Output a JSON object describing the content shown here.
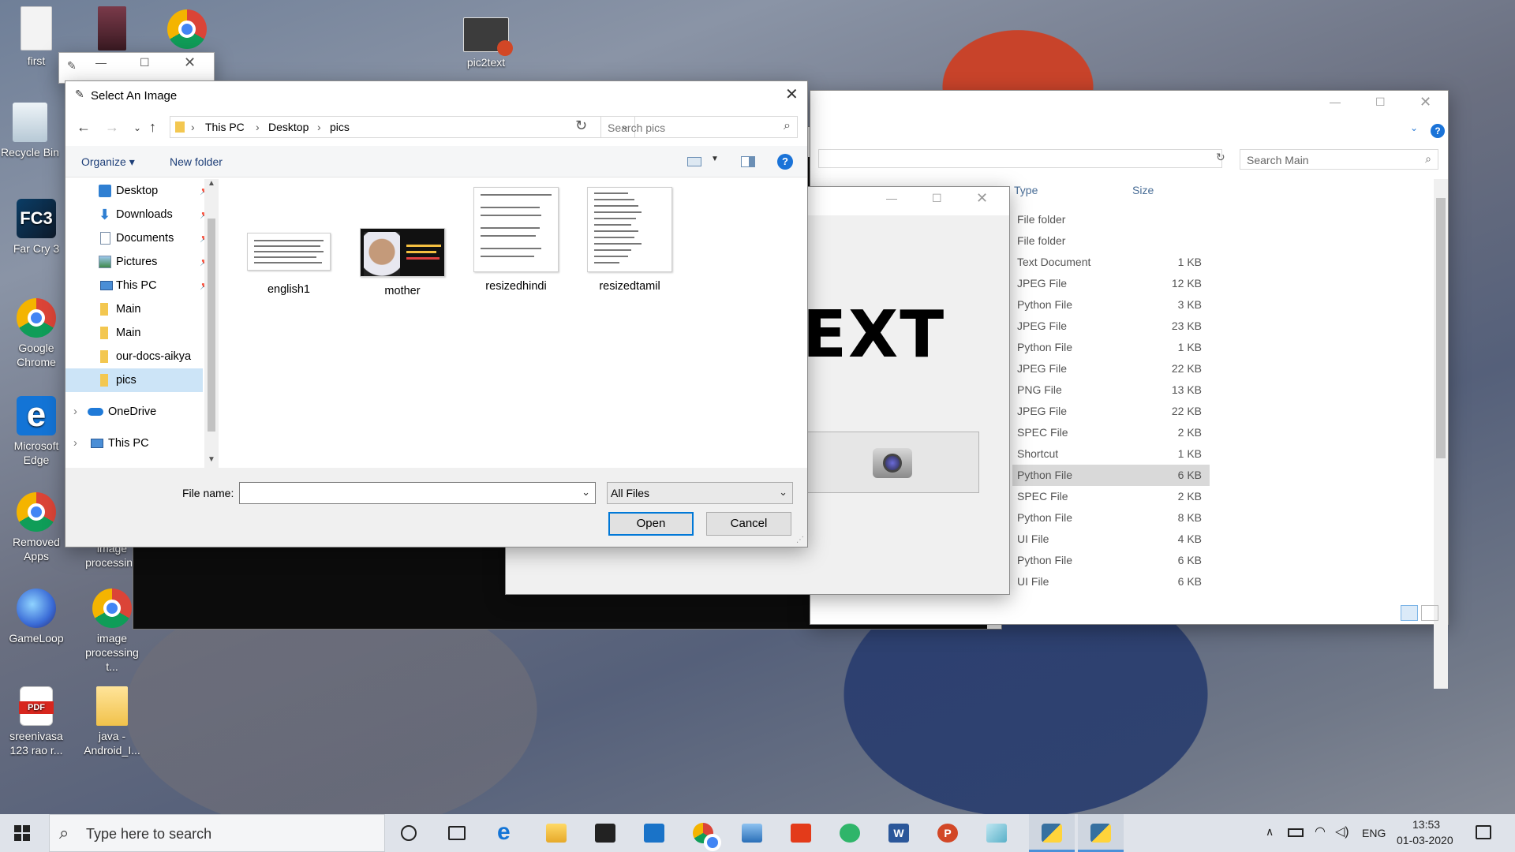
{
  "desktop_icons": [
    {
      "label": "first",
      "icon": "text-file-icon"
    },
    {
      "label": "Recycle Bin",
      "icon": "recycle-bin-icon"
    },
    {
      "label": "Far Cry 3",
      "icon": "far-cry-3-icon"
    },
    {
      "label": "Google Chrome",
      "icon": "chrome-icon"
    },
    {
      "label": "Microsoft Edge",
      "icon": "edge-icon"
    },
    {
      "label": "Removed Apps",
      "icon": "chrome-icon"
    },
    {
      "label": "image processing",
      "icon": "folder-icon"
    },
    {
      "label": "GameLoop",
      "icon": "gameloop-icon"
    },
    {
      "label": "image processing t...",
      "icon": "chrome-icon"
    },
    {
      "label": "sreenivasa 123 rao r...",
      "icon": "pdf-icon"
    },
    {
      "label": "java - Android_I...",
      "icon": "folder-icon"
    },
    {
      "label": "pic2text",
      "icon": "powerpoint-file-icon"
    }
  ],
  "explorer": {
    "search_placeholder": "Search Main",
    "columns": {
      "type": "Type",
      "size": "Size"
    },
    "rows": [
      {
        "type": "File folder",
        "size": ""
      },
      {
        "type": "File folder",
        "size": ""
      },
      {
        "type": "Text Document",
        "size": "1 KB"
      },
      {
        "type": "JPEG File",
        "size": "12 KB"
      },
      {
        "type": "Python File",
        "size": "3 KB"
      },
      {
        "type": "JPEG File",
        "size": "23 KB"
      },
      {
        "type": "Python File",
        "size": "1 KB"
      },
      {
        "type": "JPEG File",
        "size": "22 KB"
      },
      {
        "type": "PNG File",
        "size": "13 KB"
      },
      {
        "type": "JPEG File",
        "size": "22 KB"
      },
      {
        "type": "SPEC File",
        "size": "2 KB"
      },
      {
        "type": "Shortcut",
        "size": "1 KB"
      },
      {
        "type": "Python File",
        "size": "6 KB"
      },
      {
        "type": "SPEC File",
        "size": "2 KB"
      },
      {
        "type": "Python File",
        "size": "8 KB"
      },
      {
        "type": "UI File",
        "size": "4 KB"
      },
      {
        "type": "Python File",
        "size": "6 KB"
      },
      {
        "type": "UI File",
        "size": "6 KB"
      }
    ]
  },
  "app_window": {
    "heading": "EXT"
  },
  "dialog": {
    "title": "Select An Image",
    "breadcrumb": [
      "This PC",
      "Desktop",
      "pics"
    ],
    "search_placeholder": "Search pics",
    "toolbar": {
      "organize": "Organize",
      "new_folder": "New folder"
    },
    "nav_items": [
      {
        "label": "Desktop",
        "icon": "desktop-icon",
        "pinned": true
      },
      {
        "label": "Downloads",
        "icon": "downloads-icon",
        "pinned": true
      },
      {
        "label": "Documents",
        "icon": "documents-icon",
        "pinned": true
      },
      {
        "label": "Pictures",
        "icon": "pictures-icon",
        "pinned": true
      },
      {
        "label": "This PC",
        "icon": "this-pc-icon",
        "pinned": true
      },
      {
        "label": "Main",
        "icon": "folder-icon",
        "pinned": false
      },
      {
        "label": "Main",
        "icon": "folder-icon",
        "pinned": false
      },
      {
        "label": "our-docs-aikya",
        "icon": "folder-icon",
        "pinned": false
      },
      {
        "label": "pics",
        "icon": "folder-icon",
        "pinned": false
      }
    ],
    "nav_roots": [
      {
        "label": "OneDrive",
        "icon": "onedrive-icon"
      },
      {
        "label": "This PC",
        "icon": "this-pc-icon"
      }
    ],
    "files": [
      {
        "name": "english1"
      },
      {
        "name": "mother"
      },
      {
        "name": "resizedhindi"
      },
      {
        "name": "resizedtamil"
      }
    ],
    "file_name_label": "File name:",
    "file_name_value": "",
    "file_type": "All Files",
    "open_label": "Open",
    "cancel_label": "Cancel"
  },
  "taskbar": {
    "search_placeholder": "Type here to search",
    "language": "ENG",
    "time": "13:53",
    "date": "01-03-2020"
  }
}
